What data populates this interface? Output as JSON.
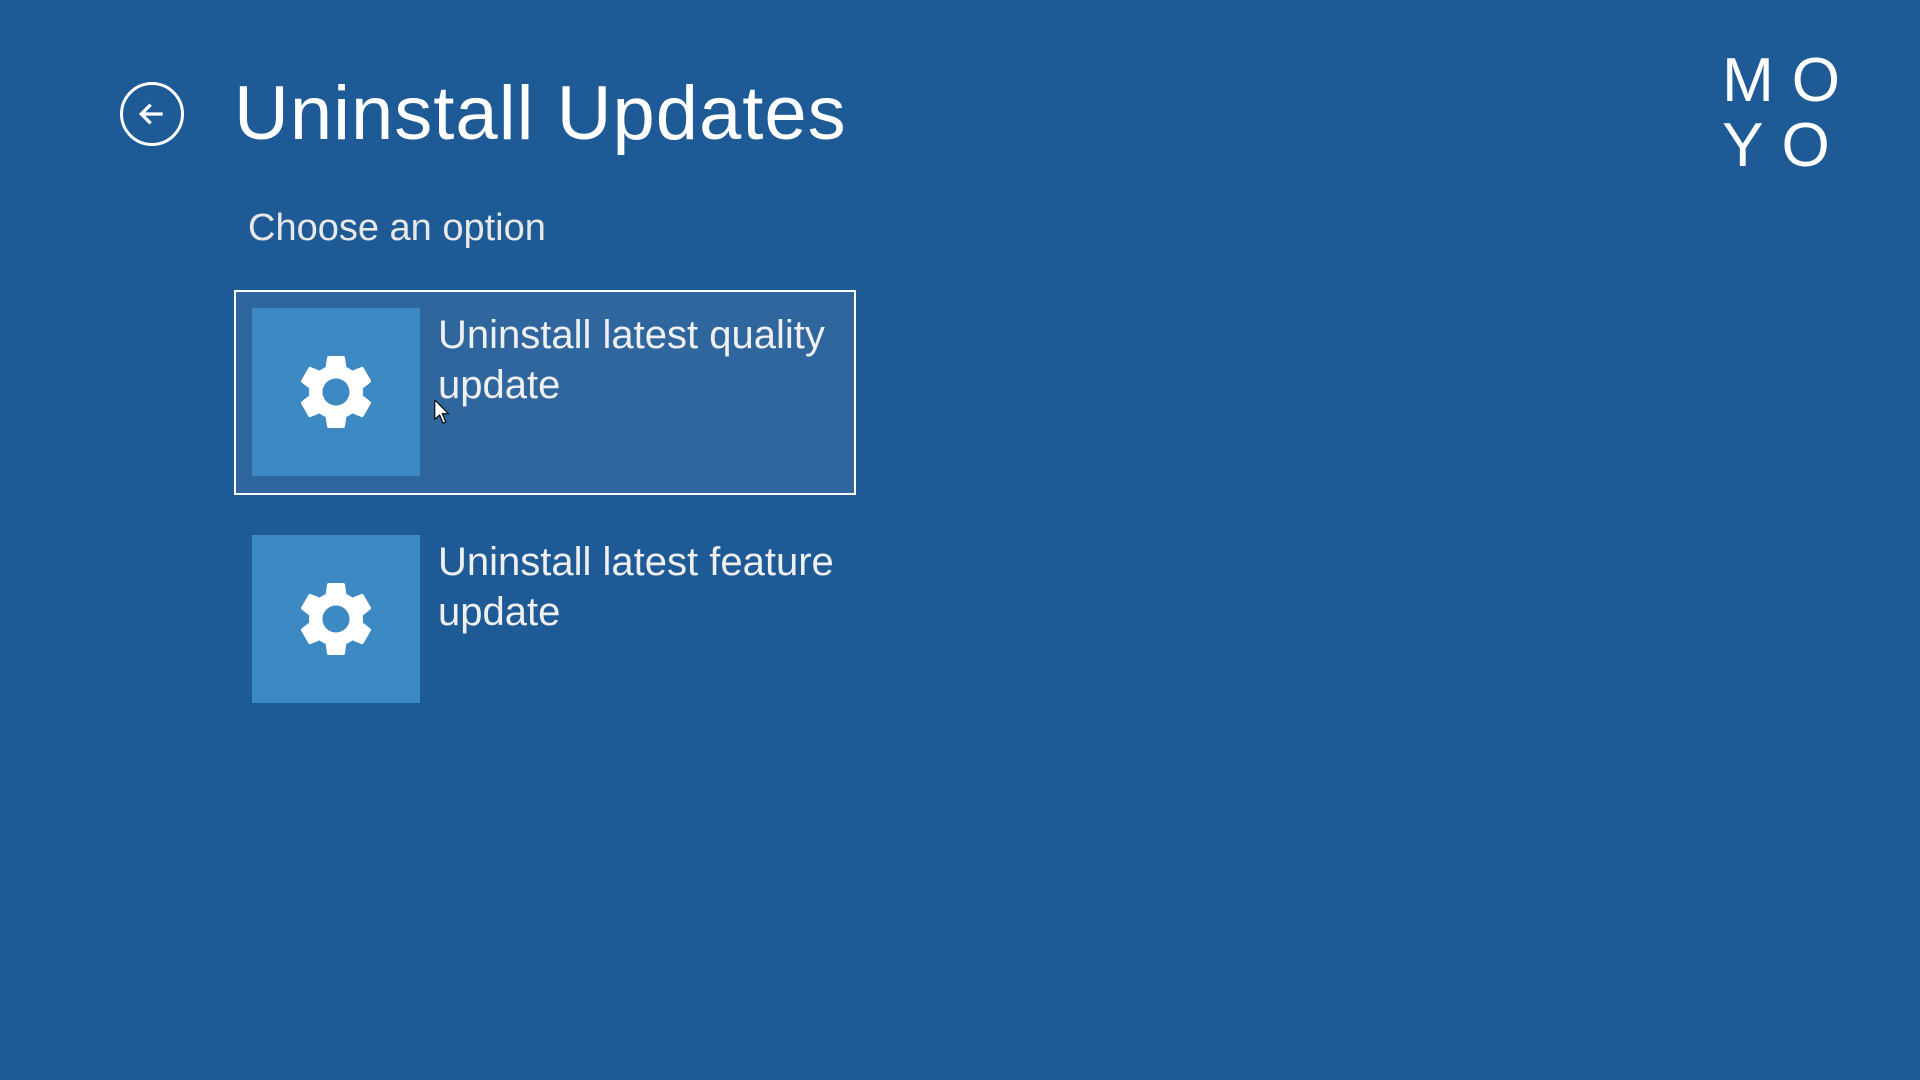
{
  "header": {
    "title": "Uninstall Updates"
  },
  "subtitle": "Choose an option",
  "options": [
    {
      "label": "Uninstall latest quality update",
      "selected": true
    },
    {
      "label": "Uninstall latest feature update",
      "selected": false
    }
  ],
  "watermark": {
    "line1": "MO",
    "line2": "YO"
  },
  "colors": {
    "background": "#1e5a96",
    "tile_icon_bg": "#3d89c4",
    "text": "#ffffff"
  }
}
